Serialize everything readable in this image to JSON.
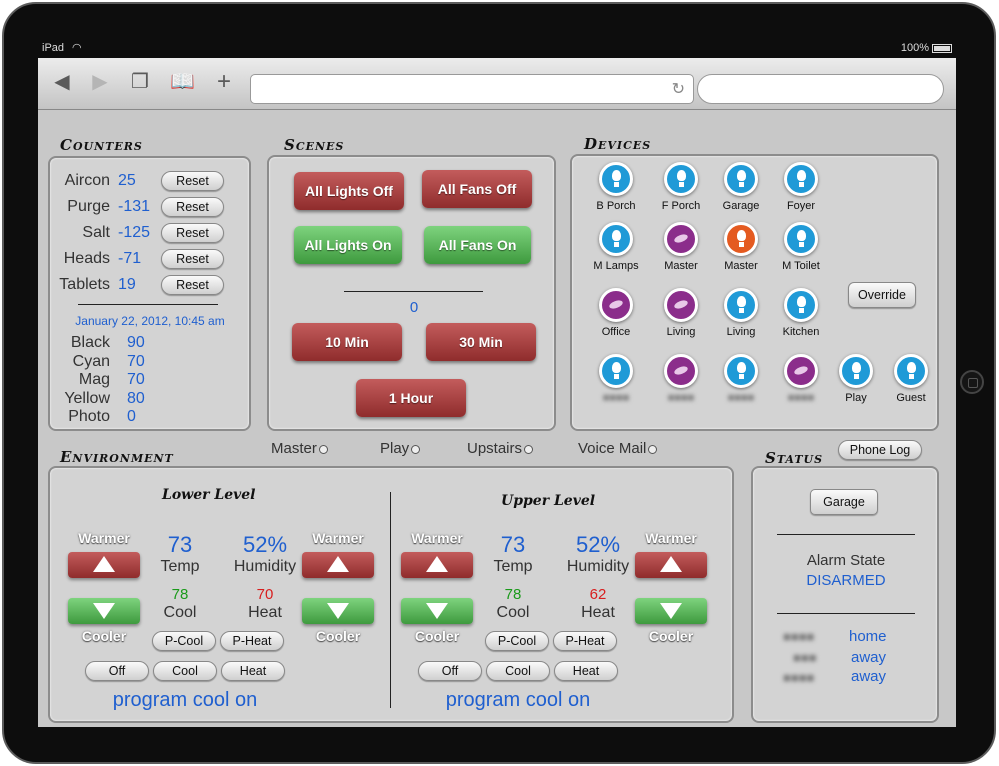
{
  "device": {
    "name": "iPad",
    "battery": "100%"
  },
  "browser": {
    "url": "",
    "search": ""
  },
  "counters": {
    "title": "Counters",
    "rows": [
      {
        "label": "Aircon",
        "value": "25",
        "button": "Reset"
      },
      {
        "label": "Purge",
        "value": "-131",
        "button": "Reset"
      },
      {
        "label": "Salt",
        "value": "-125",
        "button": "Reset"
      },
      {
        "label": "Heads",
        "value": "-71",
        "button": "Reset"
      },
      {
        "label": "Tablets",
        "value": "19",
        "button": "Reset"
      }
    ],
    "date": "January 22, 2012, 10:45 am",
    "ink": [
      {
        "label": "Black",
        "value": "90"
      },
      {
        "label": "Cyan",
        "value": "70"
      },
      {
        "label": "Mag",
        "value": "70"
      },
      {
        "label": "Yellow",
        "value": "80"
      },
      {
        "label": "Photo",
        "value": "0"
      }
    ]
  },
  "scenes": {
    "title": "Scenes",
    "all_lights_off": "All Lights Off",
    "all_fans_off": "All Fans Off",
    "all_lights_on": "All Lights On",
    "all_fans_on": "All Fans On",
    "timer_value": "0",
    "ten_min": "10 Min",
    "thirty_min": "30 Min",
    "one_hour": "1 Hour"
  },
  "devices": {
    "title": "Devices",
    "items": [
      {
        "label": "B Porch",
        "type": "light"
      },
      {
        "label": "F Porch",
        "type": "light"
      },
      {
        "label": "Garage",
        "type": "light"
      },
      {
        "label": "Foyer",
        "type": "light"
      },
      {
        "label": "M Lamps",
        "type": "light"
      },
      {
        "label": "Master",
        "type": "fan"
      },
      {
        "label": "Master",
        "type": "on"
      },
      {
        "label": "M Toilet",
        "type": "light"
      },
      {
        "label": "Office",
        "type": "fan"
      },
      {
        "label": "Living",
        "type": "fan"
      },
      {
        "label": "Living",
        "type": "light"
      },
      {
        "label": "Kitchen",
        "type": "light"
      },
      {
        "label": "",
        "type": "light"
      },
      {
        "label": "",
        "type": "fan"
      },
      {
        "label": "",
        "type": "light"
      },
      {
        "label": "",
        "type": "fan"
      },
      {
        "label": "Play",
        "type": "light"
      },
      {
        "label": "Guest",
        "type": "light"
      }
    ],
    "override": "Override"
  },
  "zones": [
    "Master",
    "Play",
    "Upstairs",
    "Voice Mail"
  ],
  "environment": {
    "title": "Environment",
    "warmer": "Warmer",
    "cooler": "Cooler",
    "temp_label": "Temp",
    "humidity_label": "Humidity",
    "cool_label": "Cool",
    "heat_label": "Heat",
    "pcool": "P-Cool",
    "pheat": "P-Heat",
    "off": "Off",
    "cool": "Cool",
    "heat": "Heat",
    "lower": {
      "title": "Lower Level",
      "temp": "73",
      "humidity": "52%",
      "cool_set": "78",
      "heat_set": "70",
      "program": "program cool on"
    },
    "upper": {
      "title": "Upper Level",
      "temp": "73",
      "humidity": "52%",
      "cool_set": "78",
      "heat_set": "62",
      "program": "program cool on"
    }
  },
  "status": {
    "title": "Status",
    "phone_log": "Phone Log",
    "garage": "Garage",
    "alarm_label": "Alarm State",
    "alarm_value": "DISARMED",
    "presence": [
      "home",
      "away",
      "away"
    ]
  }
}
